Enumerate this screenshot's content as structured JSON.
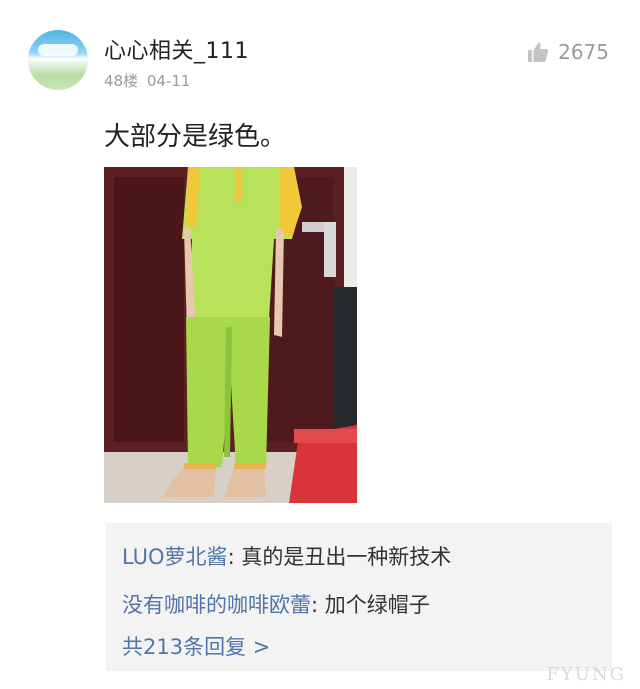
{
  "post": {
    "username": "心心相关_111",
    "floor": "48楼",
    "date": "04-11",
    "like_count": "2675",
    "content": "大部分是绿色。"
  },
  "replies": {
    "items": [
      {
        "name": "LUO萝北酱",
        "text": ": 真的是丑出一种新技术"
      },
      {
        "name": "没有咖啡的咖啡欧蕾",
        "text": ": 加个绿帽子"
      }
    ],
    "more_label": "共213条回复 >"
  },
  "watermark": "FYUNG",
  "icons": {
    "like": "thumbs-up-icon"
  },
  "colors": {
    "accent": "#5175a8",
    "muted": "#9b9b9b",
    "reply_bg": "#f3f3f3"
  }
}
